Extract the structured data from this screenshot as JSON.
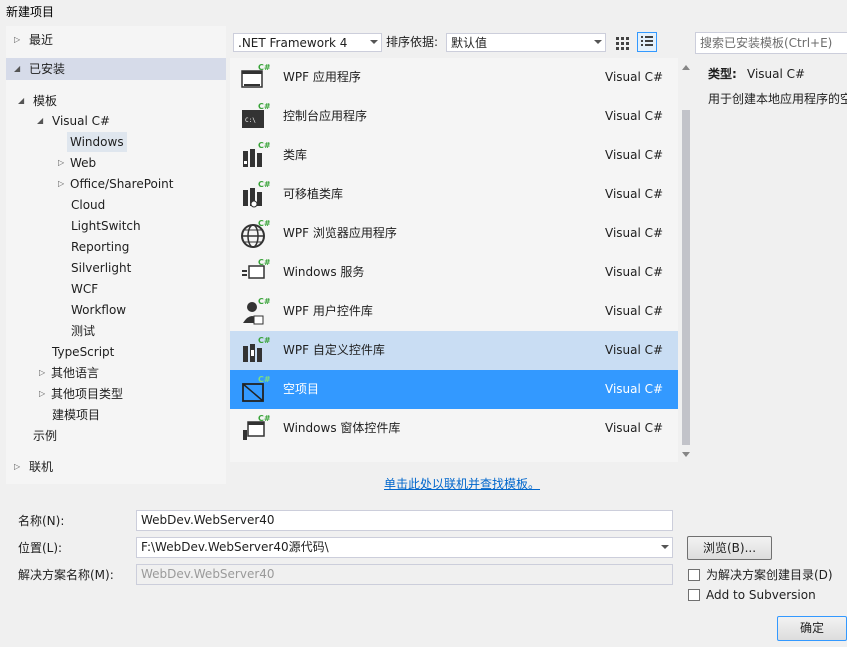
{
  "window": {
    "title": "新建项目"
  },
  "tree": {
    "recent": "最近",
    "installed": "已安装",
    "templates": "模板",
    "visual_csharp": "Visual C#",
    "windows": "Windows",
    "web": "Web",
    "office_sharepoint": "Office/SharePoint",
    "cloud": "Cloud",
    "lightswitch": "LightSwitch",
    "reporting": "Reporting",
    "silverlight": "Silverlight",
    "wcf": "WCF",
    "workflow": "Workflow",
    "test": "测试",
    "typescript": "TypeScript",
    "other_languages": "其他语言",
    "other_project_types": "其他项目类型",
    "modeling_projects": "建模项目",
    "samples": "示例",
    "online": "联机"
  },
  "toolbar": {
    "framework": ".NET Framework 4",
    "sort_label": "排序依据:",
    "sort_value": "默认值"
  },
  "templates": [
    {
      "name": "WPF 应用程序",
      "lang": "Visual C#",
      "icon": "wpf-app-icon"
    },
    {
      "name": "控制台应用程序",
      "lang": "Visual C#",
      "icon": "console-app-icon"
    },
    {
      "name": "类库",
      "lang": "Visual C#",
      "icon": "class-library-icon"
    },
    {
      "name": "可移植类库",
      "lang": "Visual C#",
      "icon": "portable-library-icon"
    },
    {
      "name": "WPF 浏览器应用程序",
      "lang": "Visual C#",
      "icon": "globe-icon"
    },
    {
      "name": "Windows 服务",
      "lang": "Visual C#",
      "icon": "windows-service-icon"
    },
    {
      "name": "WPF 用户控件库",
      "lang": "Visual C#",
      "icon": "user-control-icon"
    },
    {
      "name": "WPF 自定义控件库",
      "lang": "Visual C#",
      "icon": "custom-control-icon"
    },
    {
      "name": "空项目",
      "lang": "Visual C#",
      "icon": "empty-project-icon"
    },
    {
      "name": "Windows 窗体控件库",
      "lang": "Visual C#",
      "icon": "forms-control-icon"
    }
  ],
  "online_link": "单击此处以联机并查找模板。",
  "search": {
    "placeholder": "搜索已安装模板(Ctrl+E)"
  },
  "details": {
    "type_label": "类型:",
    "type_value": "Visual C#",
    "description": "用于创建本地应用程序的空"
  },
  "form": {
    "name_label": "名称(N):",
    "name_value": "WebDev.WebServer40",
    "location_label": "位置(L):",
    "location_value": "F:\\WebDev.WebServer40源代码\\",
    "solution_label": "解决方案名称(M):",
    "solution_value": "WebDev.WebServer40",
    "browse_button": "浏览(B)...",
    "create_dir_label": "为解决方案创建目录(D)",
    "add_svn_label": "Add to Subversion",
    "ok_button": "确定"
  },
  "colors": {
    "selection": "#3399ff",
    "hover": "#c9ddf3",
    "link": "#0066cc",
    "csharp_green": "#39a339"
  }
}
